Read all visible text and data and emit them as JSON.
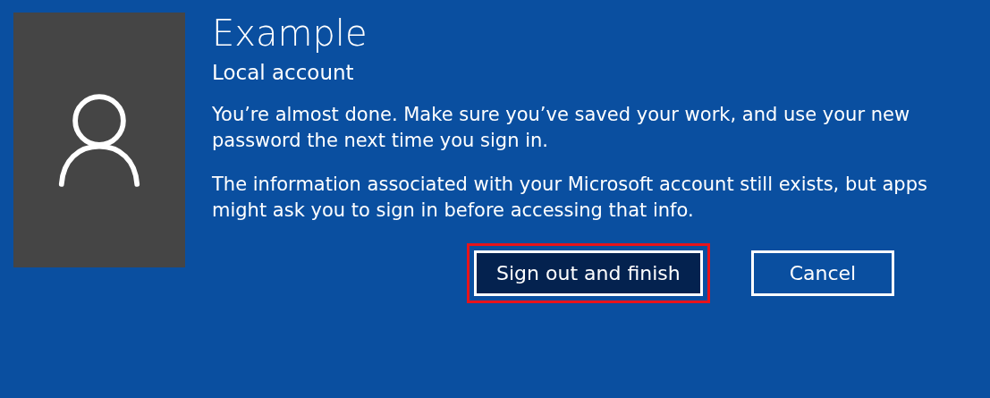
{
  "account": {
    "name": "Example",
    "type": "Local account"
  },
  "paragraphs": [
    "You’re almost done. Make sure you’ve saved your work, and use your new password the next time you sign in.",
    "The information associated with your Microsoft account still exists, but apps might ask you to sign in before accessing that info."
  ],
  "buttons": [
    {
      "label": "Sign out and finish",
      "kind": "primary",
      "highlighted": true
    },
    {
      "label": "Cancel",
      "kind": "secondary",
      "highlighted": false
    }
  ]
}
